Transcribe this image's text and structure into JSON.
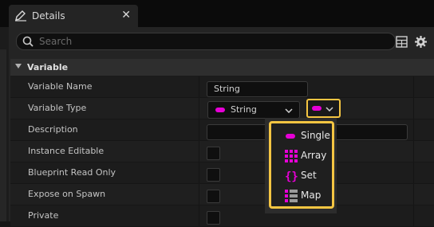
{
  "tab": {
    "title": "Details",
    "close_glyph": "✕",
    "icon": "pencil-icon"
  },
  "search": {
    "placeholder": "Search"
  },
  "toolbar": {
    "icons": [
      "table-view-icon",
      "gear-icon"
    ]
  },
  "section": {
    "title": "Variable"
  },
  "properties": [
    {
      "label": "Variable Name"
    },
    {
      "label": "Variable Type"
    },
    {
      "label": "Description"
    },
    {
      "label": "Instance Editable"
    },
    {
      "label": "Blueprint Read Only"
    },
    {
      "label": "Expose on Spawn"
    },
    {
      "label": "Private"
    }
  ],
  "variable_name": {
    "value": "String"
  },
  "variable_type": {
    "value": "String",
    "pin_color": "#e600d6"
  },
  "description": {
    "value": ""
  },
  "container_menu": {
    "highlight_color": "#f4c542",
    "items": [
      {
        "label": "Single",
        "icon": "single-pill-icon"
      },
      {
        "label": "Array",
        "icon": "array-grid-icon"
      },
      {
        "label": "Set",
        "icon": "set-braces-icon"
      },
      {
        "label": "Map",
        "icon": "map-icon"
      }
    ]
  }
}
